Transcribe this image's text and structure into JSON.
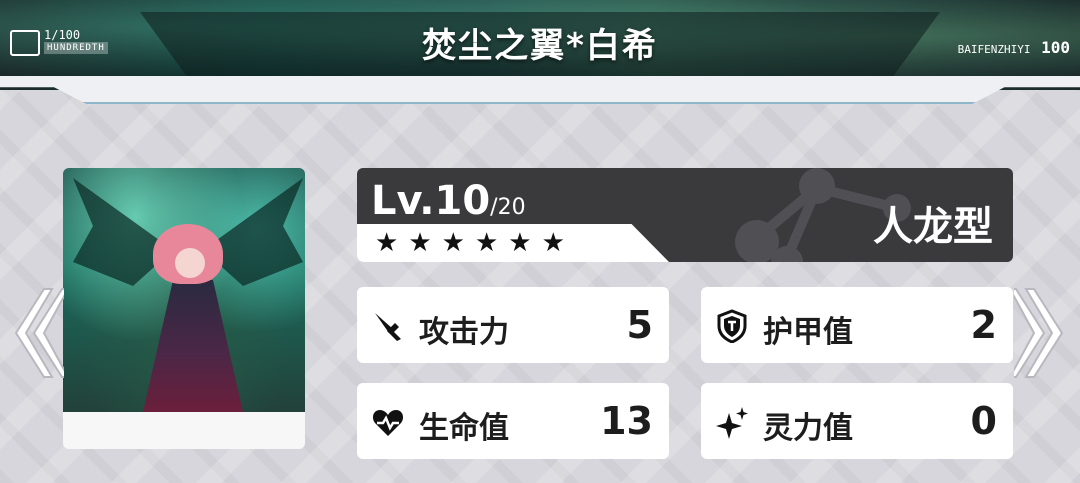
{
  "header": {
    "title": "焚尘之翼*白希",
    "left_badge": {
      "count": "1/100",
      "sub": "HUNDREDTH"
    },
    "right_badge": {
      "code": "BAIFENZHIYI",
      "number": "100"
    }
  },
  "card": {
    "level_prefix": "Lv.10",
    "level_max": "/20",
    "stars": 6,
    "type": "人龙型"
  },
  "stats": {
    "attack": {
      "label": "攻击力",
      "value": "5",
      "icon": "sword-icon"
    },
    "armor": {
      "label": "护甲值",
      "value": "2",
      "icon": "shield-icon"
    },
    "hp": {
      "label": "生命值",
      "value": "13",
      "icon": "heart-icon"
    },
    "spirit": {
      "label": "灵力值",
      "value": "0",
      "icon": "sparkle-icon"
    }
  },
  "colors": {
    "panel_dark": "#3a3a3d",
    "card_bg": "#ffffff",
    "background": "#d6d6dc"
  }
}
